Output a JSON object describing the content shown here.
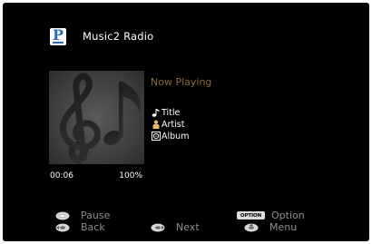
{
  "header": {
    "service_icon": "pandora-p-icon",
    "service_icon_letter": "P",
    "title": "Music2 Radio"
  },
  "now_playing": {
    "heading": "Now Playing",
    "title_label": "Title",
    "artist_label": "Artist",
    "album_label": "Album",
    "title_icon": "music-note-icon",
    "artist_icon": "person-icon",
    "album_icon": "album-icon"
  },
  "album_art": {
    "icon": "music-notes-placeholder-icon"
  },
  "playback": {
    "elapsed": "00:06",
    "progress": "100%"
  },
  "controls": {
    "pause_label": "Pause",
    "back_label": "Back",
    "next_label": "Next",
    "option_label": "Option",
    "option_badge": "OPTION",
    "menu_label": "Menu"
  },
  "colors": {
    "background": "#000000",
    "heading_accent": "#8b6a3e",
    "control_text": "#8f8f8f",
    "text": "#ffffff"
  }
}
